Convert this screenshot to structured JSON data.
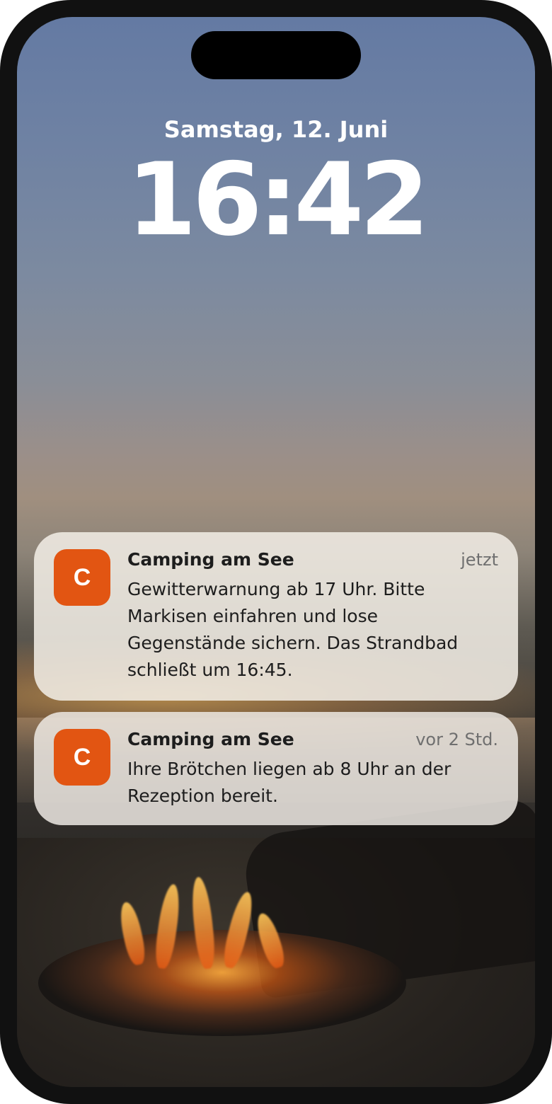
{
  "lockscreen": {
    "date": "Samstag, 12. Juni",
    "time": "16:42"
  },
  "notifications": [
    {
      "icon_letter": "C",
      "icon_color": "#e25512",
      "app": "Camping am See",
      "timestamp": "jetzt",
      "message": "Gewitterwarnung ab 17 Uhr. Bitte Markisen einfahren und lose Gegenstände sichern. Das Strandbad schließt um 16:45."
    },
    {
      "icon_letter": "C",
      "icon_color": "#e25512",
      "app": "Camping am See",
      "timestamp": "vor 2 Std.",
      "message": "Ihre Brötchen liegen ab 8 Uhr an der Rezeption bereit."
    }
  ]
}
